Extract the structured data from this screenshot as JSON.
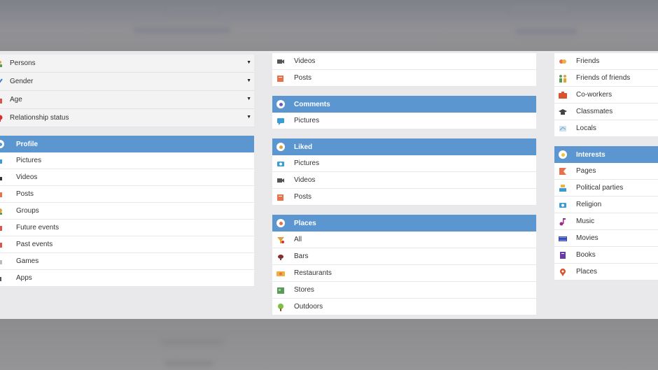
{
  "filters": [
    {
      "label": "Persons",
      "icon": "people-icon"
    },
    {
      "label": "Gender",
      "icon": "gender-icon"
    },
    {
      "label": "Age",
      "icon": "age-icon"
    },
    {
      "label": "Relationship status",
      "icon": "heart-icon"
    }
  ],
  "profile": {
    "title": "Profile",
    "items": [
      "Pictures",
      "Videos",
      "Posts",
      "Groups",
      "Future events",
      "Past events",
      "Games",
      "Apps"
    ]
  },
  "middle": {
    "top_items": [
      "Videos",
      "Posts"
    ],
    "comments": {
      "title": "Comments",
      "items": [
        "Pictures"
      ]
    },
    "liked": {
      "title": "Liked",
      "items": [
        "Pictures",
        "Videos",
        "Posts"
      ]
    },
    "places": {
      "title": "Places",
      "items": [
        "All",
        "Bars",
        "Restaurants",
        "Stores",
        "Outdoors"
      ]
    }
  },
  "right": {
    "top_items": [
      "Friends",
      "Friends of friends",
      "Co-workers",
      "Classmates",
      "Locals"
    ],
    "interests": {
      "title": "Interests",
      "items": [
        "Pages",
        "Political parties",
        "Religion",
        "Music",
        "Movies",
        "Books",
        "Places"
      ]
    }
  },
  "colors": {
    "header": "#5b96d0",
    "panel_bg": "#e9e9eb"
  }
}
